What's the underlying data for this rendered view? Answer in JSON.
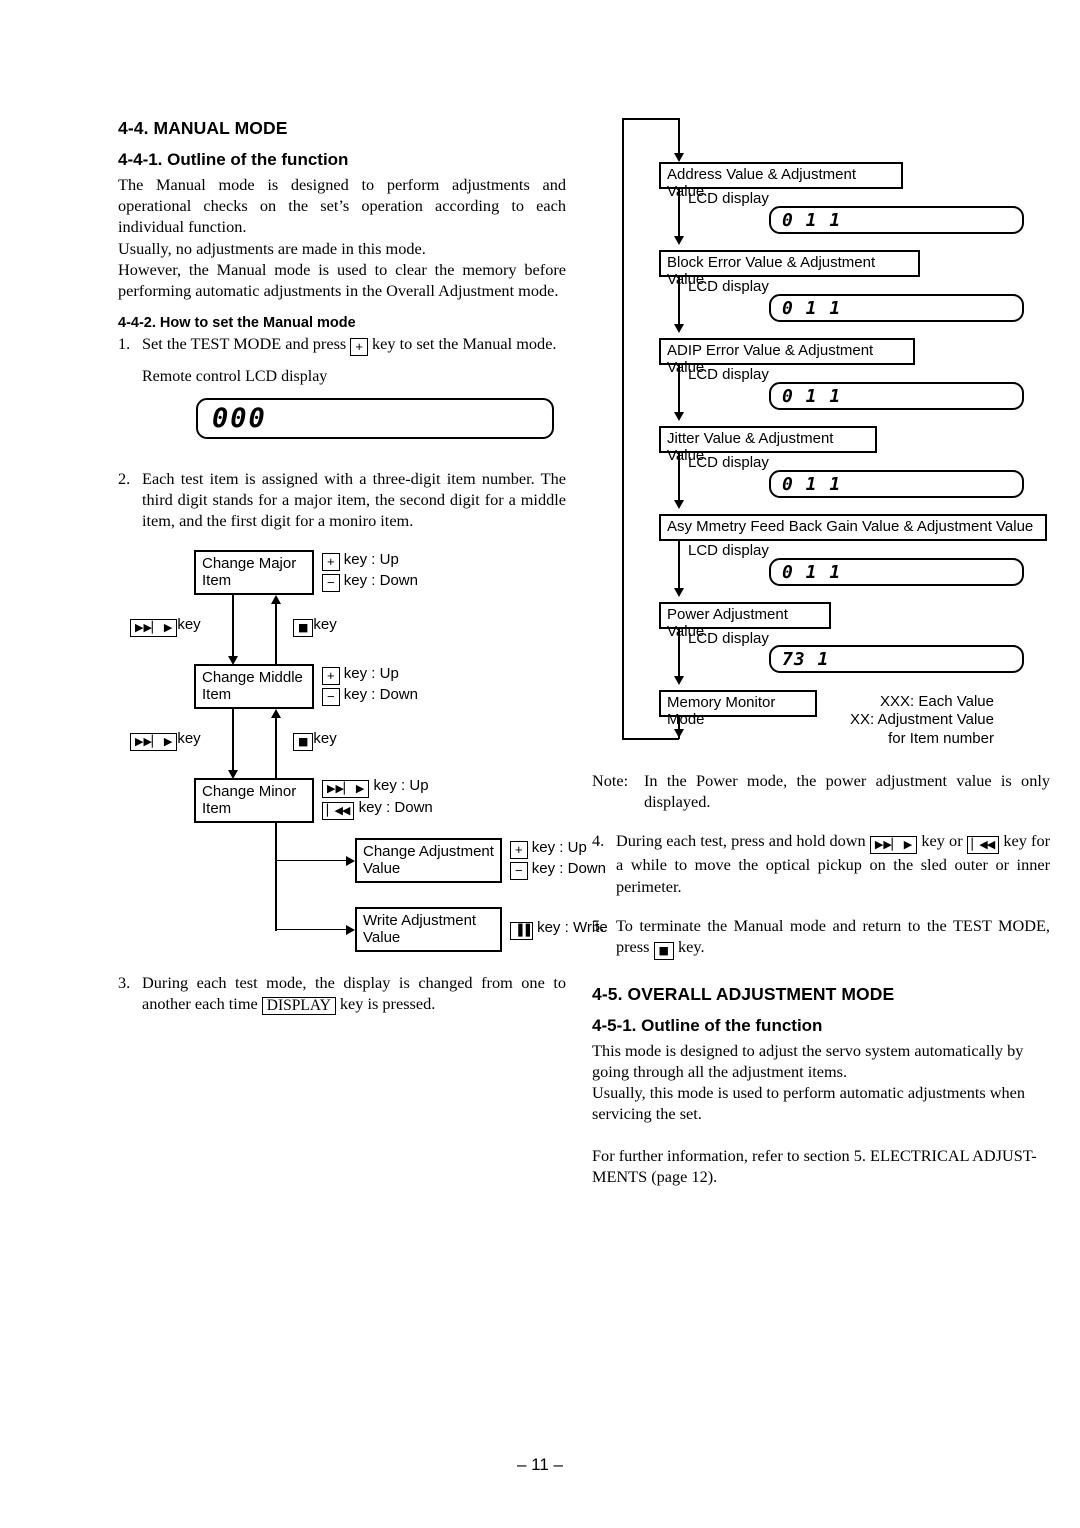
{
  "page_number": "– 11 –",
  "left": {
    "section_title": "4-4. MANUAL MODE",
    "subsection_1_title": "4-4-1. Outline of the function",
    "para_1": "The Manual mode is designed to perform adjustments and operational checks on the set’s operation according to each individual function.",
    "para_2": "Usually, no adjustments are made in this mode.",
    "para_3": "However, the Manual mode is used to clear the memory before performing automatic adjustments in the Overall Adjustment mode.",
    "subsection_2_title": "4-4-2. How to set the Manual mode",
    "step1_marker": "1.",
    "step1_a": "Set the TEST MODE and press",
    "step1_key": "+",
    "step1_b": "key to set the Manual mode.",
    "lcd_caption": "Remote control LCD display",
    "lcd_value": "000",
    "step2_marker": "2.",
    "step2_text": "Each test item is assigned with a three-digit item number.  The third digit stands for a major item, the second digit for a middle item, and the first digit for a moniro item.",
    "step3_marker": "3.",
    "step3_a": "During each test mode, the display is changed from one to another each time",
    "step3_key": "DISPLAY",
    "step3_b": "key is pressed."
  },
  "flow_left": {
    "nodes": [
      {
        "line1": "Change Major",
        "line2": "Item"
      },
      {
        "line1": "Change Middle",
        "line2": "Item"
      },
      {
        "line1": "Change Minor",
        "line2": "Item"
      },
      {
        "line1": "Change Adjustment",
        "line2": "Value"
      },
      {
        "line1": "Write Adjustment",
        "line2": "Value"
      }
    ],
    "keys_major": [
      {
        "icon": "plus-key",
        "glyph": "+",
        "text": "key : Up"
      },
      {
        "icon": "minus-key",
        "glyph": "−",
        "text": "key : Down"
      }
    ],
    "keys_middle": [
      {
        "icon": "plus-key",
        "glyph": "+",
        "text": "key : Up"
      },
      {
        "icon": "minus-key",
        "glyph": "−",
        "text": "key : Down"
      }
    ],
    "keys_minor": [
      {
        "icon": "fast-forward-key",
        "glyph": "▶▶▏ ▶",
        "text": "key : Up"
      },
      {
        "icon": "rewind-key",
        "glyph": "▏◀◀",
        "text": "key : Down"
      }
    ],
    "keys_adjust": [
      {
        "icon": "plus-key",
        "glyph": "+",
        "text": "key : Up"
      },
      {
        "icon": "minus-key",
        "glyph": "−",
        "text": "key : Down"
      }
    ],
    "keys_write": [
      {
        "icon": "pause-key",
        "glyph": "▐▐",
        "text": "key : Write"
      }
    ],
    "edge_down_1": {
      "icon": "fast-forward-key",
      "glyph": "▶▶▏ ▶",
      "text": "key"
    },
    "edge_up_1": {
      "icon": "stop-key",
      "glyph": "■",
      "text": "key"
    },
    "edge_down_2": {
      "icon": "fast-forward-key",
      "glyph": "▶▶▏ ▶",
      "text": "key"
    },
    "edge_up_2": {
      "icon": "stop-key",
      "glyph": "■",
      "text": "key"
    }
  },
  "flow_right": {
    "lcd_label": "LCD display",
    "items": [
      {
        "node": "Address Value & Adjustment Value",
        "lcd": "0 1 1"
      },
      {
        "node": "Block Error Value & Adjustment Value",
        "lcd": "0 1 1"
      },
      {
        "node": "ADIP Error Value & Adjustment Value",
        "lcd": "0 1 1"
      },
      {
        "node": "Jitter Value & Adjustment Value",
        "lcd": "0 1 1"
      },
      {
        "node": "Asy Mmetry Feed Back Gain Value & Adjustment Value",
        "lcd": "0 1 1"
      },
      {
        "node": "Power Adjustment Value",
        "lcd": "73 1"
      }
    ],
    "last_node": "Memory Monitor Mode",
    "legend": [
      "XXX: Each Value",
      "XX: Adjustment Value",
      "for Item number"
    ]
  },
  "right": {
    "note_marker": "Note:",
    "note_text": "In the Power mode, the power adjustment value is only displayed.",
    "step4_marker": "4.",
    "step4_a": "During each test, press and hold down",
    "step4_key1": "▶▶▏ ▶",
    "step4_mid": "key or",
    "step4_key2": "▏◀◀",
    "step4_b": "key for a while to move the optical pickup on the sled outer or inner perimeter.",
    "step5_marker": "5.",
    "step5_a": "To terminate the Manual mode and return to the TEST MODE, press",
    "step5_key": "■",
    "step5_b": "key.",
    "section_title": "4-5. OVERALL ADJUSTMENT MODE",
    "subsection_title": "4-5-1. Outline of the function",
    "para_1": "This mode is designed to adjust the servo system automatically by going through all the adjustment items.",
    "para_2": "Usually, this mode is used to perform automatic adjustments when servicing the set.",
    "para_3": "For further information, refer to section 5. ELECTRICAL ADJUST-MENTS (page 12)."
  }
}
